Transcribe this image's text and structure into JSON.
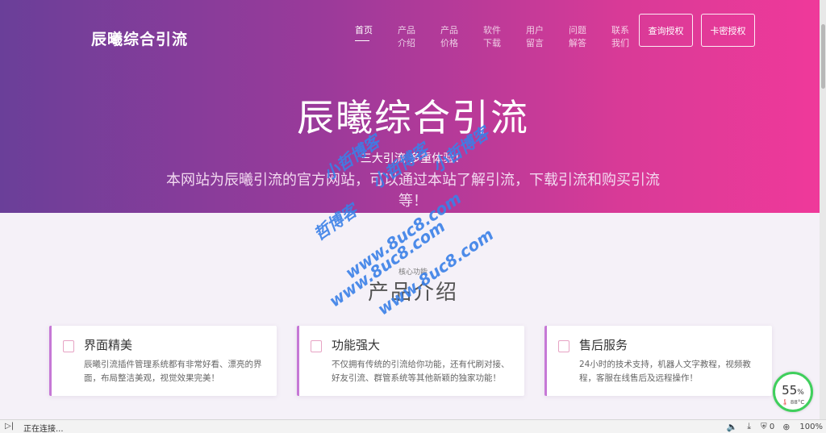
{
  "header": {
    "brand": "辰曦综合引流",
    "nav": [
      {
        "label": "首页",
        "active": true
      },
      {
        "label": "产品介绍",
        "active": false
      },
      {
        "label": "产品价格",
        "active": false
      },
      {
        "label": "软件下载",
        "active": false
      },
      {
        "label": "用户留言",
        "active": false
      },
      {
        "label": "问题解答",
        "active": false
      },
      {
        "label": "联系我们",
        "active": false
      }
    ],
    "btn_query": "查询授权",
    "btn_card": "卡密授权"
  },
  "hero": {
    "title": "辰曦综合引流",
    "subtitle": "三大引流 多重体验！",
    "description": "本网站为辰曦引流的官方网站，可以通过本站了解引流，下载引流和购买引流等！"
  },
  "section": {
    "tag": "核心功能",
    "title": "产品介绍"
  },
  "features": [
    {
      "title": "界面精美",
      "text": "辰曦引流插件管理系统都有非常好看、漂亮的界面，布局整洁美观，视觉效果完美！"
    },
    {
      "title": "功能强大",
      "text": "不仅拥有传统的引流给你功能，还有代刷对接、好友引流、群管系统等其他新颖的独家功能！"
    },
    {
      "title": "售后服务",
      "text": "24小时的技术支持，机器人文字教程，视频教程，客服在线售后及远程操作！"
    }
  ],
  "perf": {
    "percent": "55",
    "unit": "%",
    "temp": "88°C"
  },
  "statusbar": {
    "status": "正在连接...",
    "badge_count": "0",
    "zoom": "100%"
  },
  "watermark": {
    "lines": [
      "小哲博客",
      "小哲博客",
      "小哲博客",
      "哲博客",
      "www.8uc8.com",
      "www.8uc8.com",
      "www.8uc8.com"
    ]
  },
  "colors": {
    "gradient_start": "#6a3f99",
    "gradient_end": "#f0399a",
    "accent": "#c678d6"
  }
}
